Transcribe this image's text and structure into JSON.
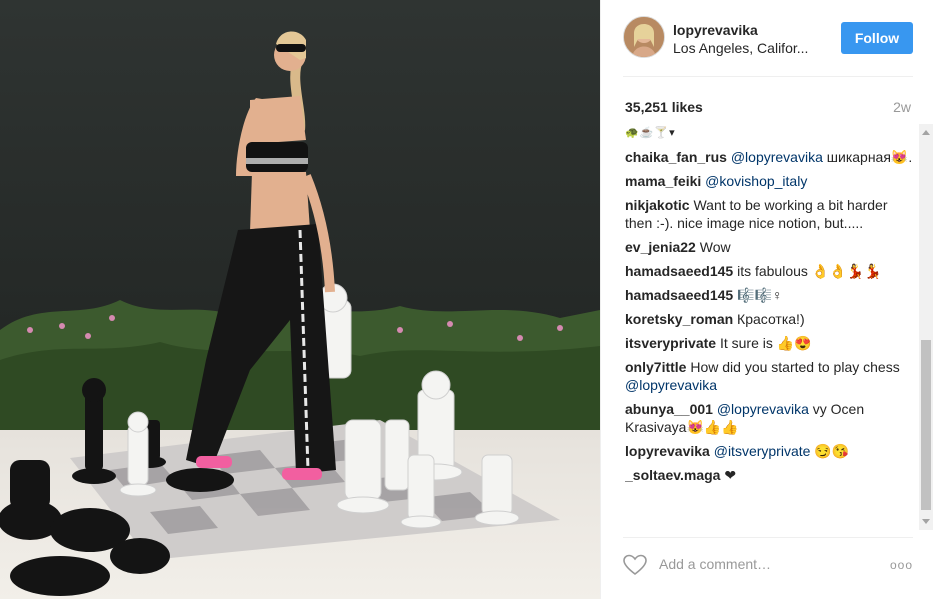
{
  "post": {
    "username": "lopyrevavika",
    "location": "Los Angeles, Califor...",
    "follow_label": "Follow",
    "likes": "35,251 likes",
    "age": "2w"
  },
  "comments": [
    {
      "user": "chaika_fan_rus",
      "mention": "@lopyrevavika",
      "text": " шикарная😻."
    },
    {
      "user": "mama_feiki",
      "mention": "@kovishop_italy",
      "text": ""
    },
    {
      "user": "nikjakotic",
      "mention": "",
      "text": " Want to be working a bit harder then :-). nice image nice notion, but....."
    },
    {
      "user": "ev_jenia22",
      "mention": "",
      "text": " Wow"
    },
    {
      "user": "hamadsaeed145",
      "mention": "",
      "text": " its fabulous 👌👌💃💃"
    },
    {
      "user": "hamadsaeed145",
      "mention": "",
      "text": " 🎼🎼♀"
    },
    {
      "user": "koretsky_roman",
      "mention": "",
      "text": " Красотка!)"
    },
    {
      "user": "itsveryprivate",
      "mention": "",
      "text": " It sure is 👍😍"
    },
    {
      "user": "only7ittle",
      "mention": "",
      "text": " How did you started to play chess ",
      "mention_after": "@lopyrevavika"
    },
    {
      "user": "abunya__001",
      "mention": "@lopyrevavika",
      "text": " vy Ocen Krasivaya😻👍👍"
    },
    {
      "user": "lopyrevavika",
      "mention": "@itsveryprivate",
      "text": " 😏😘"
    },
    {
      "user": "_soltaev.maga",
      "mention": "",
      "text": " ❤"
    }
  ],
  "top_emoji": "🐢☕🍸▾",
  "footer": {
    "add_comment_placeholder": "Add a comment…",
    "more_label": "ooo"
  },
  "colors": {
    "follow_blue": "#3897f0",
    "mention_blue": "#003569",
    "muted": "#999999"
  },
  "icons": {
    "like": "heart-icon",
    "more": "more-options-icon"
  }
}
